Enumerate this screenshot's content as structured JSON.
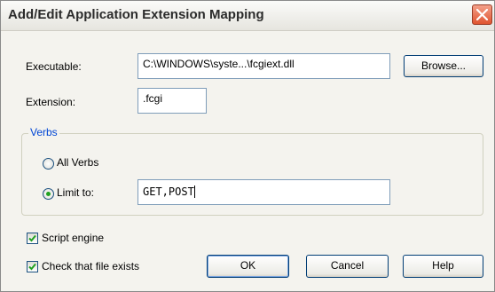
{
  "dialog": {
    "title": "Add/Edit Application Extension Mapping"
  },
  "executable": {
    "label": "Executable:",
    "value": "C:\\WINDOWS\\syste...\\fcgiext.dll"
  },
  "browse": {
    "label": "Browse..."
  },
  "extension": {
    "label": "Extension:",
    "value": ".fcgi"
  },
  "verbs": {
    "group_label": "Verbs",
    "all_verbs": {
      "label": "All Verbs",
      "selected": false
    },
    "limit_to": {
      "label": "Limit to:",
      "selected": true,
      "value": "GET,POST"
    }
  },
  "script_engine": {
    "label": "Script engine",
    "checked": true
  },
  "check_file": {
    "label": "Check that file exists",
    "checked": true
  },
  "buttons": {
    "ok": "OK",
    "cancel": "Cancel",
    "help": "Help"
  }
}
